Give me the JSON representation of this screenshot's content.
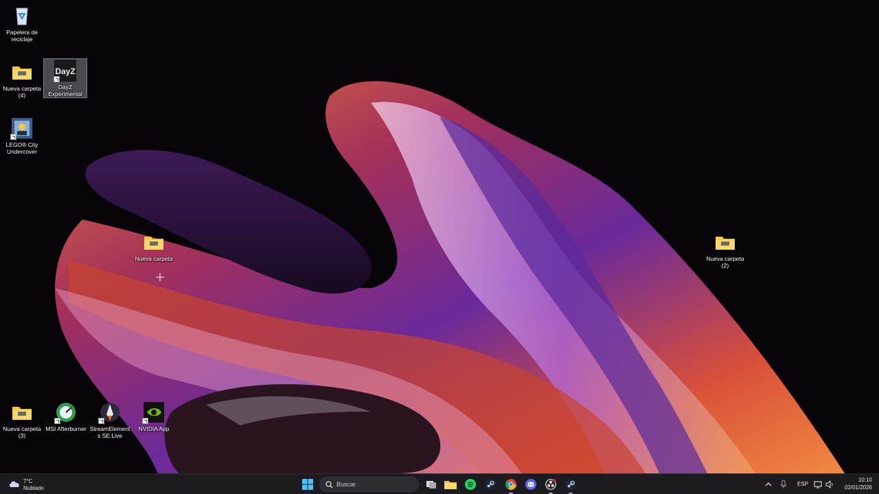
{
  "desktop": {
    "icons": [
      {
        "label": "Papelera de reciclaje",
        "icon": "recycle-bin-icon"
      },
      {
        "label": "Nueva carpeta (4)",
        "icon": "folder-icon"
      },
      {
        "label": "DayZ Experimental",
        "icon": "dayz-icon",
        "logo_text": "DayZ"
      },
      {
        "label": "LEGO® City Undercover",
        "icon": "lego-city-icon"
      },
      {
        "label": "Nueva carpeta",
        "icon": "folder-icon"
      },
      {
        "label": "Nueva carpeta (2)",
        "icon": "folder-icon"
      },
      {
        "label": "Nueva carpeta (3)",
        "icon": "folder-icon"
      },
      {
        "label": "MSI Afterburner",
        "icon": "msi-afterburner-icon"
      },
      {
        "label": "StreamElements SE.Live",
        "icon": "streamelements-icon"
      },
      {
        "label": "NVIDIA App",
        "icon": "nvidia-icon"
      }
    ],
    "selected_icon": "DayZ Experimental"
  },
  "taskbar": {
    "weather": {
      "temp": "7°C",
      "condition": "Nublado",
      "icon": "cloud-icon"
    },
    "search_placeholder": "Buscar",
    "pinned": [
      "start-icon",
      "search-icon",
      "task-view-icon",
      "file-explorer-icon",
      "spotify-icon",
      "steam-icon",
      "chrome-icon",
      "discord-icon",
      "obs-icon",
      "steam-icon"
    ],
    "tray": {
      "language": "ESP",
      "time": "10:10",
      "date": "02/01/2026"
    }
  },
  "colors": {
    "taskbar_bg": "#1c1b1f",
    "folder_yellow": "#f2c94c",
    "wallpaper_purple": "#5a2a6e",
    "wallpaper_orange": "#e0602a"
  }
}
